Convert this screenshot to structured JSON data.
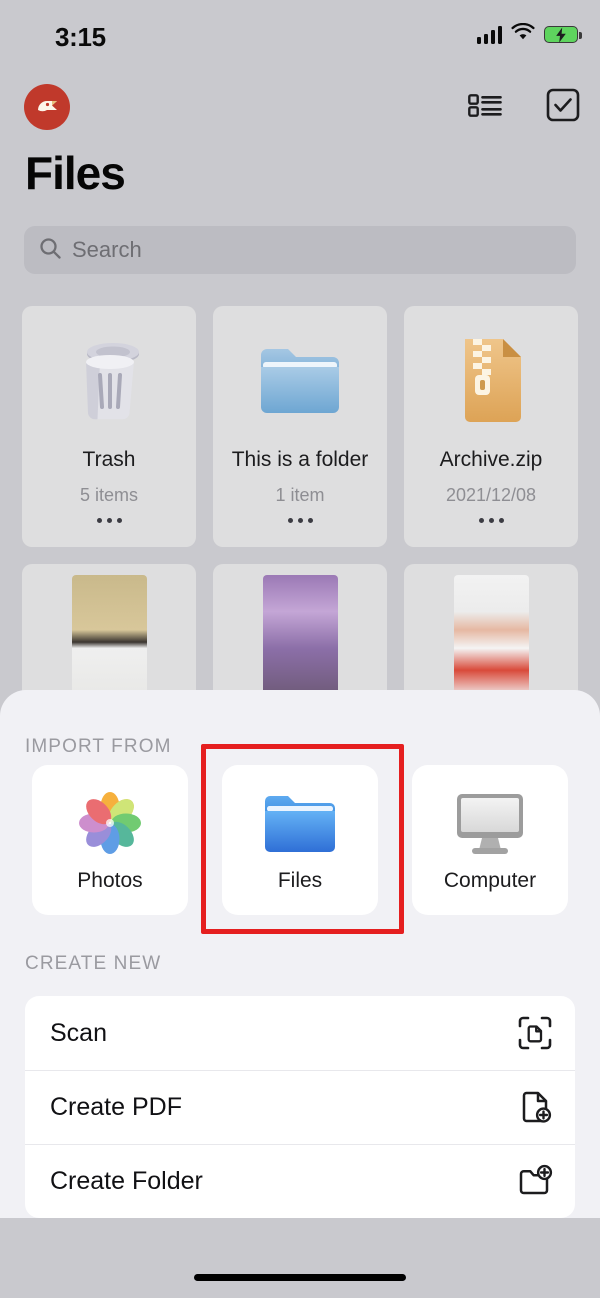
{
  "status_bar": {
    "time": "3:15",
    "signal_icon": "cellular-signal-icon",
    "wifi_icon": "wifi-icon",
    "battery_icon": "battery-charging-icon"
  },
  "nav_bar": {
    "avatar_icon": "account-avatar-icon",
    "list_view_icon": "list-view-icon",
    "select_icon": "select-checkbox-icon"
  },
  "header": {
    "title": "Files"
  },
  "search": {
    "placeholder": "Search",
    "value": "",
    "icon": "search-icon"
  },
  "file_grid": {
    "items": [
      {
        "name": "Trash",
        "meta": "5 items",
        "icon": "trash-can-icon",
        "more": "more-options-icon"
      },
      {
        "name": "This is a folder",
        "meta": "1 item",
        "icon": "folder-icon",
        "more": "more-options-icon"
      },
      {
        "name": "Archive.zip",
        "meta": "2021/12/08",
        "icon": "zip-archive-icon",
        "more": "more-options-icon"
      }
    ]
  },
  "photo_row": {
    "items": [
      {
        "name": "photo-thumbnail-whiteboard"
      },
      {
        "name": "photo-thumbnail-performance"
      },
      {
        "name": "photo-thumbnail-app-screenshot"
      }
    ]
  },
  "sheet": {
    "import_section": {
      "label": "IMPORT FROM",
      "options": [
        {
          "label": "Photos",
          "icon": "photos-app-icon",
          "highlighted": false
        },
        {
          "label": "Files",
          "icon": "files-folder-icon",
          "highlighted": true
        },
        {
          "label": "Computer",
          "icon": "computer-monitor-icon",
          "highlighted": false
        }
      ]
    },
    "create_section": {
      "label": "CREATE NEW",
      "rows": [
        {
          "label": "Scan",
          "icon": "scan-document-icon"
        },
        {
          "label": "Create PDF",
          "icon": "document-plus-icon"
        },
        {
          "label": "Create Folder",
          "icon": "folder-plus-icon"
        }
      ]
    }
  },
  "home_indicator": {
    "name": "home-indicator"
  },
  "colors": {
    "highlight": "#e51f1f",
    "avatar_background": "#c0392b",
    "battery_green": "#5ed45e",
    "folder_blue": "#3b82e0",
    "sheet_background": "#f1f1f5",
    "page_background": "#c9c9ce",
    "card_background": "#dededf"
  }
}
